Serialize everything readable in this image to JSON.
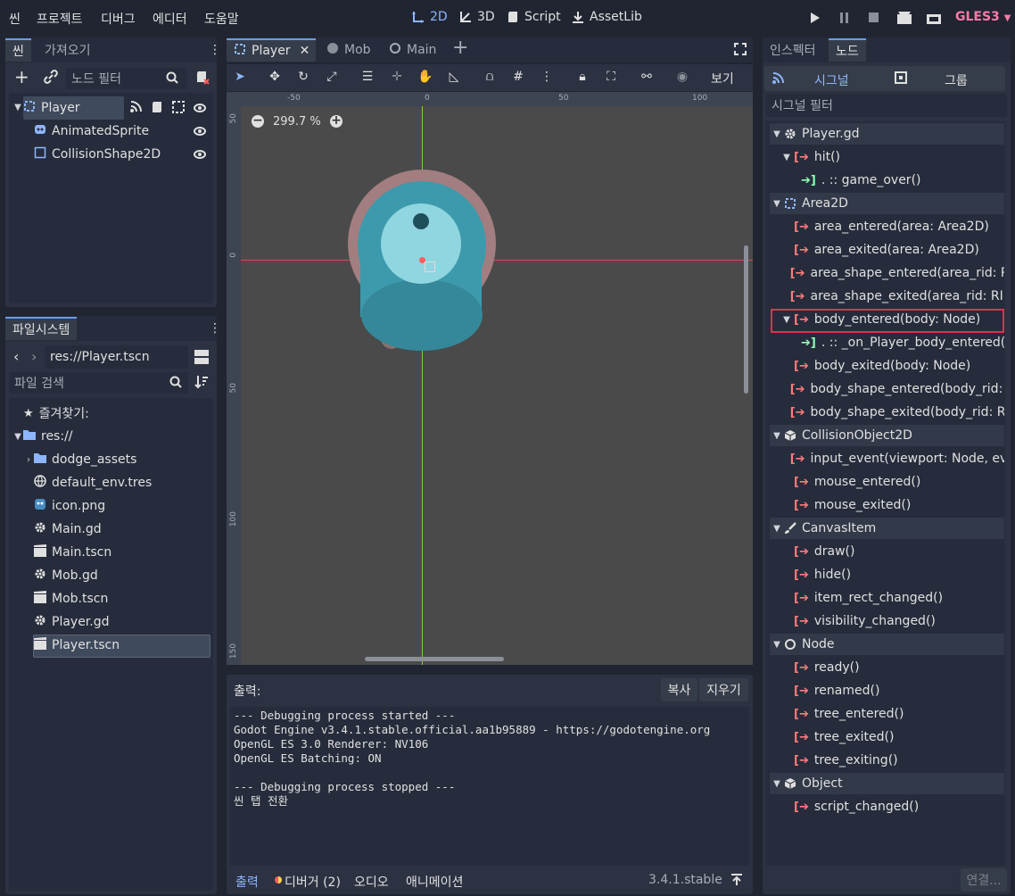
{
  "menu": [
    "씬",
    "프로젝트",
    "디버그",
    "에디터",
    "도움말"
  ],
  "modes": {
    "d2": "2D",
    "d3": "3D",
    "script": "Script",
    "assetlib": "AssetLib"
  },
  "renderer": "GLES3",
  "scene_dock": {
    "tabs": [
      "씬",
      "가져오기"
    ],
    "filter_placeholder": "노드 필터",
    "nodes": [
      {
        "label": "Player",
        "icon": "node2d-icon"
      },
      {
        "label": "AnimatedSprite",
        "icon": "sprite-icon"
      },
      {
        "label": "CollisionShape2D",
        "icon": "shape-icon"
      }
    ]
  },
  "fs_dock": {
    "title": "파일시스템",
    "path": "res://Player.tscn",
    "search_placeholder": "파일 검색",
    "favorites": "즐겨찾기:",
    "root": "res://",
    "items": [
      "dodge_assets",
      "default_env.tres",
      "icon.png",
      "Main.gd",
      "Main.tscn",
      "Mob.gd",
      "Mob.tscn",
      "Player.gd",
      "Player.tscn"
    ]
  },
  "editor_tabs": [
    "Player",
    "Mob",
    "Main"
  ],
  "toolbar": {
    "view": "보기"
  },
  "viewport": {
    "zoom": "299.7 %",
    "ruler_top": [
      "-50",
      "0",
      "50",
      "100"
    ],
    "ruler_left": [
      "50",
      "0",
      "50",
      "100",
      "150"
    ]
  },
  "output": {
    "label": "출력:",
    "copy": "복사",
    "clear": "지우기",
    "lines": "--- Debugging process started ---\nGodot Engine v3.4.1.stable.official.aa1b95889 - https://godotengine.org\nOpenGL ES 3.0 Renderer: NV106\nOpenGL ES Batching: ON\n\n--- Debugging process stopped ---\n씬 탭 전환"
  },
  "bottom_tabs": {
    "output": "출력",
    "debugger": "디버거 (2)",
    "audio": "오디오",
    "animation": "애니메이션",
    "version": "3.4.1.stable"
  },
  "inspector_tabs": [
    "인스펙터",
    "노드"
  ],
  "node_subtabs": {
    "signals": "시그널",
    "groups": "그룹"
  },
  "signal_filter": "시그널 필터",
  "signals": [
    {
      "type": "class",
      "label": "Player.gd",
      "icon": "gear-icon"
    },
    {
      "type": "signal",
      "label": "hit()",
      "open": true
    },
    {
      "type": "conn",
      "label": ". :: game_over()"
    },
    {
      "type": "class",
      "label": "Area2D",
      "icon": "area2d-icon"
    },
    {
      "type": "signal",
      "label": "area_entered(area: Area2D)"
    },
    {
      "type": "signal",
      "label": "area_exited(area: Area2D)"
    },
    {
      "type": "signal",
      "label": "area_shape_entered(area_rid: RI"
    },
    {
      "type": "signal",
      "label": "area_shape_exited(area_rid: RID,"
    },
    {
      "type": "signal",
      "label": "body_entered(body: Node)",
      "open": true,
      "selected": true
    },
    {
      "type": "conn",
      "label": ". :: _on_Player_body_entered()"
    },
    {
      "type": "signal",
      "label": "body_exited(body: Node)"
    },
    {
      "type": "signal",
      "label": "body_shape_entered(body_rid: R"
    },
    {
      "type": "signal",
      "label": "body_shape_exited(body_rid: RI"
    },
    {
      "type": "class",
      "label": "CollisionObject2D",
      "icon": "cube-icon"
    },
    {
      "type": "signal",
      "label": "input_event(viewport: Node, eve"
    },
    {
      "type": "signal",
      "label": "mouse_entered()"
    },
    {
      "type": "signal",
      "label": "mouse_exited()"
    },
    {
      "type": "class",
      "label": "CanvasItem",
      "icon": "brush-icon"
    },
    {
      "type": "signal",
      "label": "draw()"
    },
    {
      "type": "signal",
      "label": "hide()"
    },
    {
      "type": "signal",
      "label": "item_rect_changed()"
    },
    {
      "type": "signal",
      "label": "visibility_changed()"
    },
    {
      "type": "class",
      "label": "Node",
      "icon": "circle-icon"
    },
    {
      "type": "signal",
      "label": "ready()"
    },
    {
      "type": "signal",
      "label": "renamed()"
    },
    {
      "type": "signal",
      "label": "tree_entered()"
    },
    {
      "type": "signal",
      "label": "tree_exited()"
    },
    {
      "type": "signal",
      "label": "tree_exiting()"
    },
    {
      "type": "class",
      "label": "Object",
      "icon": "cube-icon"
    },
    {
      "type": "signal",
      "label": "script_changed()"
    }
  ],
  "connect_button": "연결..."
}
